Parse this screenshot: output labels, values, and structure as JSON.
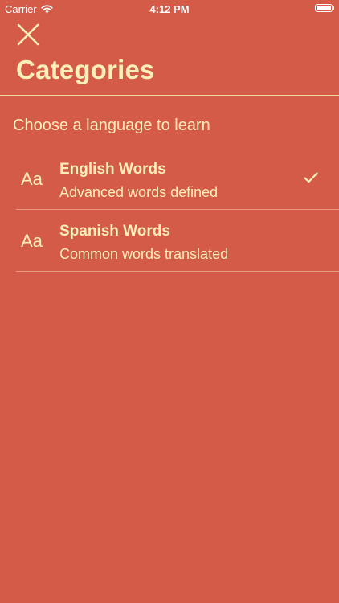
{
  "status_bar": {
    "carrier": "Carrier",
    "time": "4:12 PM"
  },
  "header": {
    "title": "Categories"
  },
  "section": {
    "header": "Choose a language to learn"
  },
  "categories": [
    {
      "icon_text": "Aa",
      "title": "English Words",
      "subtitle": "Advanced words defined",
      "selected": true
    },
    {
      "icon_text": "Aa",
      "title": "Spanish Words",
      "subtitle": "Common words translated",
      "selected": false
    }
  ],
  "colors": {
    "background": "#D45B48",
    "text": "#FCEFB8",
    "divider": "#E79A7E"
  },
  "icons": {
    "close": "close-icon",
    "check": "checkmark-icon",
    "wifi": "wifi-icon",
    "battery": "battery-icon"
  }
}
